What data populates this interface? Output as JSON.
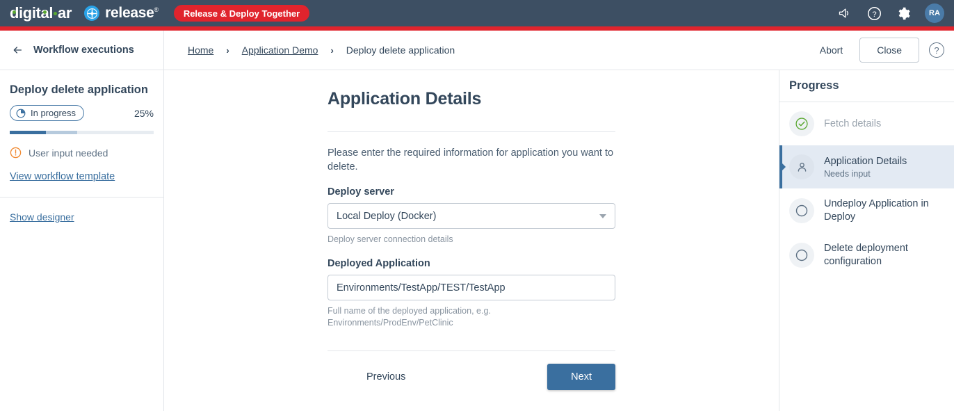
{
  "topbar": {
    "brand_primary": "digital.ai",
    "brand_secondary": "release",
    "cta_label": "Release & Deploy Together",
    "icons": [
      "megaphone-icon",
      "help-icon",
      "gear-icon"
    ],
    "avatar_initials": "RA",
    "bg_color": "#3d4f63",
    "accent_red": "#e0242d"
  },
  "subheader": {
    "back_icon": "arrow-left-icon",
    "title": "Workflow executions",
    "breadcrumbs": [
      {
        "label": "Home",
        "link": true
      },
      {
        "label": "Application Demo",
        "link": true
      },
      {
        "label": "Deploy delete application",
        "link": false
      }
    ],
    "separator": "›",
    "abort_label": "Abort",
    "close_label": "Close",
    "help_icon": "help-circle-icon"
  },
  "left_panel": {
    "title": "Deploy delete application",
    "status_badge": {
      "label": "In progress",
      "icon": "pie-clock-icon",
      "border_color": "#4a7ba8"
    },
    "percent_label": "25%",
    "progress_percent": 25,
    "progress_mid_percent": 22,
    "progress_fill_color": "#3a6f9f",
    "progress_mid_color": "#b6cadd",
    "progress_track_color": "#e7ecf1",
    "warning": {
      "icon": "alert-circle-icon",
      "text": "User input needed",
      "color": "#f08a33"
    },
    "view_template_link": "View workflow template",
    "show_designer_link": "Show designer"
  },
  "main": {
    "title": "Application Details",
    "intro": "Please enter the required information for application you want to delete.",
    "fields": [
      {
        "label": "Deploy server",
        "type": "select",
        "value": "Local Deploy (Docker)",
        "hint": "Deploy server connection details"
      },
      {
        "label": "Deployed Application",
        "type": "text",
        "value": "Environments/TestApp/TEST/TestApp",
        "hint": "Full name of the deployed application, e.g. Environments/ProdEnv/PetClinic"
      }
    ],
    "previous_label": "Previous",
    "next_label": "Next",
    "next_color": "#3a6f9f"
  },
  "right_panel": {
    "title": "Progress",
    "items": [
      {
        "label": "Fetch details",
        "sub": "",
        "state": "done",
        "icon": "check-circle-icon"
      },
      {
        "label": "Application Details",
        "sub": "Needs input",
        "state": "active",
        "icon": "user-icon"
      },
      {
        "label": "Undeploy Application in Deploy",
        "sub": "",
        "state": "pending",
        "icon": "circle-icon"
      },
      {
        "label": "Delete deployment configuration",
        "sub": "",
        "state": "pending",
        "icon": "circle-icon"
      }
    ]
  }
}
